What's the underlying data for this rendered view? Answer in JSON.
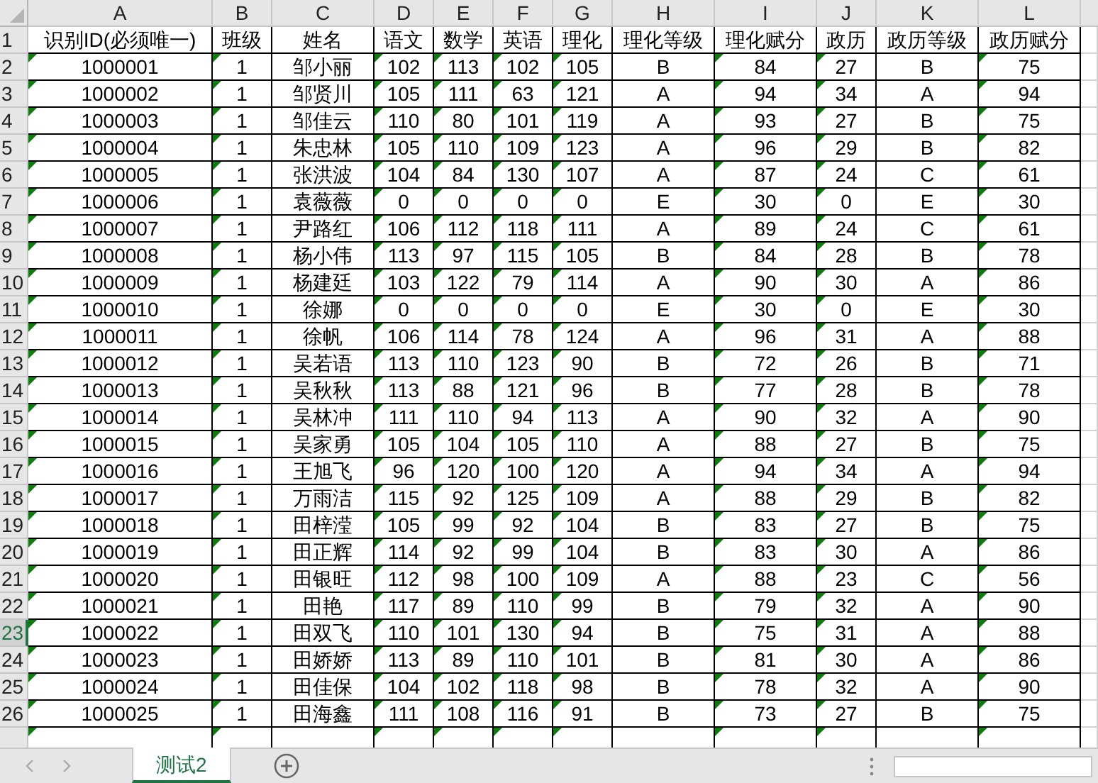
{
  "column_letters": [
    {
      "letter": "A",
      "selected": false
    },
    {
      "letter": "B",
      "selected": false
    },
    {
      "letter": "C",
      "selected": false
    },
    {
      "letter": "D",
      "selected": false
    },
    {
      "letter": "E",
      "selected": false
    },
    {
      "letter": "F",
      "selected": false
    },
    {
      "letter": "G",
      "selected": false
    },
    {
      "letter": "H",
      "selected": false
    },
    {
      "letter": "I",
      "selected": false
    },
    {
      "letter": "J",
      "selected": false
    },
    {
      "letter": "K",
      "selected": false
    },
    {
      "letter": "L",
      "selected": false
    }
  ],
  "header_row": {
    "number": "1",
    "cells": [
      "识别ID(必须唯一)",
      "班级",
      "姓名",
      "语文",
      "数学",
      "英语",
      "理化",
      "理化等级",
      "理化赋分",
      "政历",
      "政历等级",
      "政历赋分"
    ]
  },
  "flagged_columns": [
    true,
    true,
    false,
    true,
    true,
    true,
    true,
    false,
    true,
    true,
    false,
    true
  ],
  "rows": [
    {
      "number": "2",
      "selected": false,
      "cells": [
        "1000001",
        "1",
        "邹小丽",
        "102",
        "113",
        "102",
        "105",
        "B",
        "84",
        "27",
        "B",
        "75"
      ]
    },
    {
      "number": "3",
      "selected": false,
      "cells": [
        "1000002",
        "1",
        "邹贤川",
        "105",
        "111",
        "63",
        "121",
        "A",
        "94",
        "34",
        "A",
        "94"
      ]
    },
    {
      "number": "4",
      "selected": false,
      "cells": [
        "1000003",
        "1",
        "邹佳云",
        "110",
        "80",
        "101",
        "119",
        "A",
        "93",
        "27",
        "B",
        "75"
      ]
    },
    {
      "number": "5",
      "selected": false,
      "cells": [
        "1000004",
        "1",
        "朱忠林",
        "105",
        "110",
        "109",
        "123",
        "A",
        "96",
        "29",
        "B",
        "82"
      ]
    },
    {
      "number": "6",
      "selected": false,
      "cells": [
        "1000005",
        "1",
        "张洪波",
        "104",
        "84",
        "130",
        "107",
        "A",
        "87",
        "24",
        "C",
        "61"
      ]
    },
    {
      "number": "7",
      "selected": false,
      "cells": [
        "1000006",
        "1",
        "袁薇薇",
        "0",
        "0",
        "0",
        "0",
        "E",
        "30",
        "0",
        "E",
        "30"
      ]
    },
    {
      "number": "8",
      "selected": false,
      "cells": [
        "1000007",
        "1",
        "尹路红",
        "106",
        "112",
        "118",
        "111",
        "A",
        "89",
        "24",
        "C",
        "61"
      ]
    },
    {
      "number": "9",
      "selected": false,
      "cells": [
        "1000008",
        "1",
        "杨小伟",
        "113",
        "97",
        "115",
        "105",
        "B",
        "84",
        "28",
        "B",
        "78"
      ]
    },
    {
      "number": "10",
      "selected": false,
      "cells": [
        "1000009",
        "1",
        "杨建廷",
        "103",
        "122",
        "79",
        "114",
        "A",
        "90",
        "30",
        "A",
        "86"
      ]
    },
    {
      "number": "11",
      "selected": false,
      "cells": [
        "1000010",
        "1",
        "徐娜",
        "0",
        "0",
        "0",
        "0",
        "E",
        "30",
        "0",
        "E",
        "30"
      ]
    },
    {
      "number": "12",
      "selected": false,
      "cells": [
        "1000011",
        "1",
        "徐帆",
        "106",
        "114",
        "78",
        "124",
        "A",
        "96",
        "31",
        "A",
        "88"
      ]
    },
    {
      "number": "13",
      "selected": false,
      "cells": [
        "1000012",
        "1",
        "吴若语",
        "113",
        "110",
        "123",
        "90",
        "B",
        "72",
        "26",
        "B",
        "71"
      ]
    },
    {
      "number": "14",
      "selected": false,
      "cells": [
        "1000013",
        "1",
        "吴秋秋",
        "113",
        "88",
        "121",
        "96",
        "B",
        "77",
        "28",
        "B",
        "78"
      ]
    },
    {
      "number": "15",
      "selected": false,
      "cells": [
        "1000014",
        "1",
        "吴林冲",
        "111",
        "110",
        "94",
        "113",
        "A",
        "90",
        "32",
        "A",
        "90"
      ]
    },
    {
      "number": "16",
      "selected": false,
      "cells": [
        "1000015",
        "1",
        "吴家勇",
        "105",
        "104",
        "105",
        "110",
        "A",
        "88",
        "27",
        "B",
        "75"
      ]
    },
    {
      "number": "17",
      "selected": false,
      "cells": [
        "1000016",
        "1",
        "王旭飞",
        "96",
        "120",
        "100",
        "120",
        "A",
        "94",
        "34",
        "A",
        "94"
      ]
    },
    {
      "number": "18",
      "selected": false,
      "cells": [
        "1000017",
        "1",
        "万雨洁",
        "115",
        "92",
        "125",
        "109",
        "A",
        "88",
        "29",
        "B",
        "82"
      ]
    },
    {
      "number": "19",
      "selected": false,
      "cells": [
        "1000018",
        "1",
        "田梓滢",
        "105",
        "99",
        "92",
        "104",
        "B",
        "83",
        "27",
        "B",
        "75"
      ]
    },
    {
      "number": "20",
      "selected": false,
      "cells": [
        "1000019",
        "1",
        "田正辉",
        "114",
        "92",
        "99",
        "104",
        "B",
        "83",
        "30",
        "A",
        "86"
      ]
    },
    {
      "number": "21",
      "selected": false,
      "cells": [
        "1000020",
        "1",
        "田银旺",
        "112",
        "98",
        "100",
        "109",
        "A",
        "88",
        "23",
        "C",
        "56"
      ]
    },
    {
      "number": "22",
      "selected": false,
      "cells": [
        "1000021",
        "1",
        "田艳",
        "117",
        "89",
        "110",
        "99",
        "B",
        "79",
        "32",
        "A",
        "90"
      ]
    },
    {
      "number": "23",
      "selected": true,
      "cells": [
        "1000022",
        "1",
        "田双飞",
        "110",
        "101",
        "130",
        "94",
        "B",
        "75",
        "31",
        "A",
        "88"
      ]
    },
    {
      "number": "24",
      "selected": false,
      "cells": [
        "1000023",
        "1",
        "田娇娇",
        "113",
        "89",
        "110",
        "101",
        "B",
        "81",
        "30",
        "A",
        "86"
      ]
    },
    {
      "number": "25",
      "selected": false,
      "cells": [
        "1000024",
        "1",
        "田佳保",
        "104",
        "102",
        "118",
        "98",
        "B",
        "78",
        "32",
        "A",
        "90"
      ]
    },
    {
      "number": "26",
      "selected": false,
      "cells": [
        "1000025",
        "1",
        "田海鑫",
        "111",
        "108",
        "116",
        "91",
        "B",
        "73",
        "27",
        "B",
        "75"
      ]
    }
  ],
  "sheet_tabs": [
    {
      "label": "测试2",
      "selected": true
    }
  ]
}
